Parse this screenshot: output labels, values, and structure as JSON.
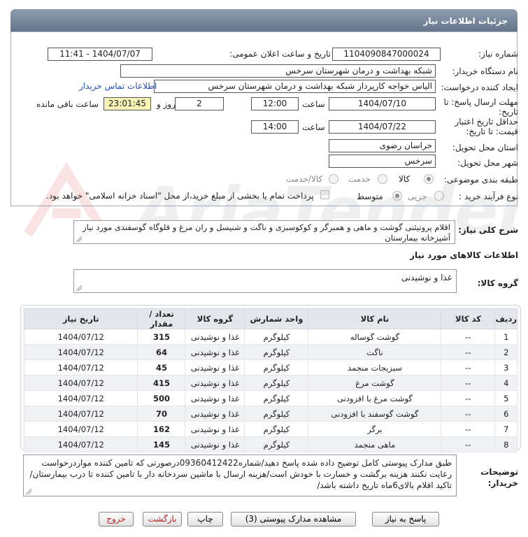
{
  "header": {
    "title": "جزئیات اطلاعات نیاز"
  },
  "form": {
    "need_number_label": "شماره نیاز:",
    "need_number": "1104090847000024",
    "announce_label": "تاریخ و ساعت اعلان عمومی:",
    "announce_value": "1404/07/07 - 11:41",
    "buyer_org_label": "نام دستگاه خریدار:",
    "buyer_org": "شبکه بهداشت و درمان شهرستان سرخس",
    "creator_label": "ایجاد کننده درخواست:",
    "creator": "الیاس خواجه کارپرداز شبکه بهداشت و درمان شهرستان سرخس",
    "contact_link": "اطلاعات تماس خریدار",
    "deadline_label_1": "مهلت ارسال پاسخ: تا",
    "deadline_label_2": "تاریخ:",
    "deadline_date": "1404/07/10",
    "time_label": "ساعت",
    "deadline_time": "12:00",
    "days_value": "2",
    "days_label": "روز و",
    "remaining_time": "23:01:45",
    "remaining_label": "ساعت باقی مانده",
    "validity_label_1": "حداقل تاریخ اعتبار",
    "validity_label_2": "قیمت: تا تاریخ:",
    "validity_date": "1404/07/22",
    "validity_time": "14:00",
    "province_label": "استان محل تحویل:",
    "province": "خراسان رضوی",
    "city_label": "شهر محل تحویل:",
    "city": "سرخس",
    "category_label": "طبقه بندی موضوعی:",
    "category_options": [
      "کالا",
      "خدمت",
      "کالا/خدمت"
    ],
    "process_label": "نوع فرآیند خرید :",
    "process_options": [
      "جزیی",
      "متوسط"
    ],
    "payment_note": "پرداخت تمام یا بخشی از مبلغ خرید،از محل \"اسناد خزانه اسلامی\" خواهد بود."
  },
  "summary": {
    "label": "شرح کلی نیاز:",
    "text": "اقلام پروتیئنی گوشت و ماهی و همبرگر و کوکوسبزی و ناگت و شنیسل و ران مرغ و قلوگاه گوسفندی مورد نیاز آشپزخانه بیمارستان"
  },
  "goods": {
    "section_title": "اطلاعات کالاهای مورد نیاز",
    "group_label": "گروه کالا:",
    "group_value": "غذا و نوشیدنی"
  },
  "table": {
    "headers": [
      "ردیف",
      "کد کالا",
      "نام کالا",
      "واحد شمارش",
      "گروه کالا",
      "تعداد / مقدار",
      "تاریخ نیاز"
    ],
    "rows": [
      [
        "1",
        "--",
        "گوشت گوساله",
        "کیلوگرم",
        "غذا و نوشیدنی",
        "315",
        "1404/07/12"
      ],
      [
        "2",
        "--",
        "ناگت",
        "کیلوگرم",
        "غذا و نوشیدنی",
        "64",
        "1404/07/12"
      ],
      [
        "3",
        "--",
        "سبزیجات منجمد",
        "کیلوگرم",
        "غذا و نوشیدنی",
        "45",
        "1404/07/12"
      ],
      [
        "4",
        "--",
        "گوشت مرغ",
        "کیلوگرم",
        "غذا و نوشیدنی",
        "415",
        "1404/07/12"
      ],
      [
        "5",
        "--",
        "گوشت مرغ با افزودنی",
        "کیلوگرم",
        "غذا و نوشیدنی",
        "500",
        "1404/07/12"
      ],
      [
        "6",
        "--",
        "گوشت گوسفند با افزودنی",
        "کیلوگرم",
        "غذا و نوشیدنی",
        "70",
        "1404/07/12"
      ],
      [
        "7",
        "--",
        "برگر",
        "کیلوگرم",
        "غذا و نوشیدنی",
        "162",
        "1404/07/12"
      ],
      [
        "8",
        "--",
        "ماهی منجمد",
        "کیلوگرم",
        "غذا و نوشیدنی",
        "145",
        "1404/07/12"
      ]
    ]
  },
  "notes": {
    "label_1": "توضیحات",
    "label_2": "خریدار:",
    "text": "طبق مدارک پیوستی کامل توضیح داده شده پاسخ دهید/شماره09360412422درصورتی که تامین کننده مواردرخواست رعایت نکنند هزینه برگشت و خسارت با خودش است/هزینه ارسال با ماشین سردخانه دار با تامین کننده تا درب بیمارستان/ تاکید اقلام بالای6ماه تاریخ داشته باشد/"
  },
  "buttons": {
    "reply": "پاسخ به نیاز",
    "attachments": "مشاهده مدارک پیوستی (3)",
    "print": "چاپ",
    "back": "بازگشت",
    "exit": "خروج"
  },
  "watermark": {
    "text": "AriaTender.neT"
  },
  "colors": {
    "header": "#7a889b",
    "link": "#1f4fbf",
    "remaining_bg": "#f7f3b5",
    "exit": "#b22222"
  }
}
